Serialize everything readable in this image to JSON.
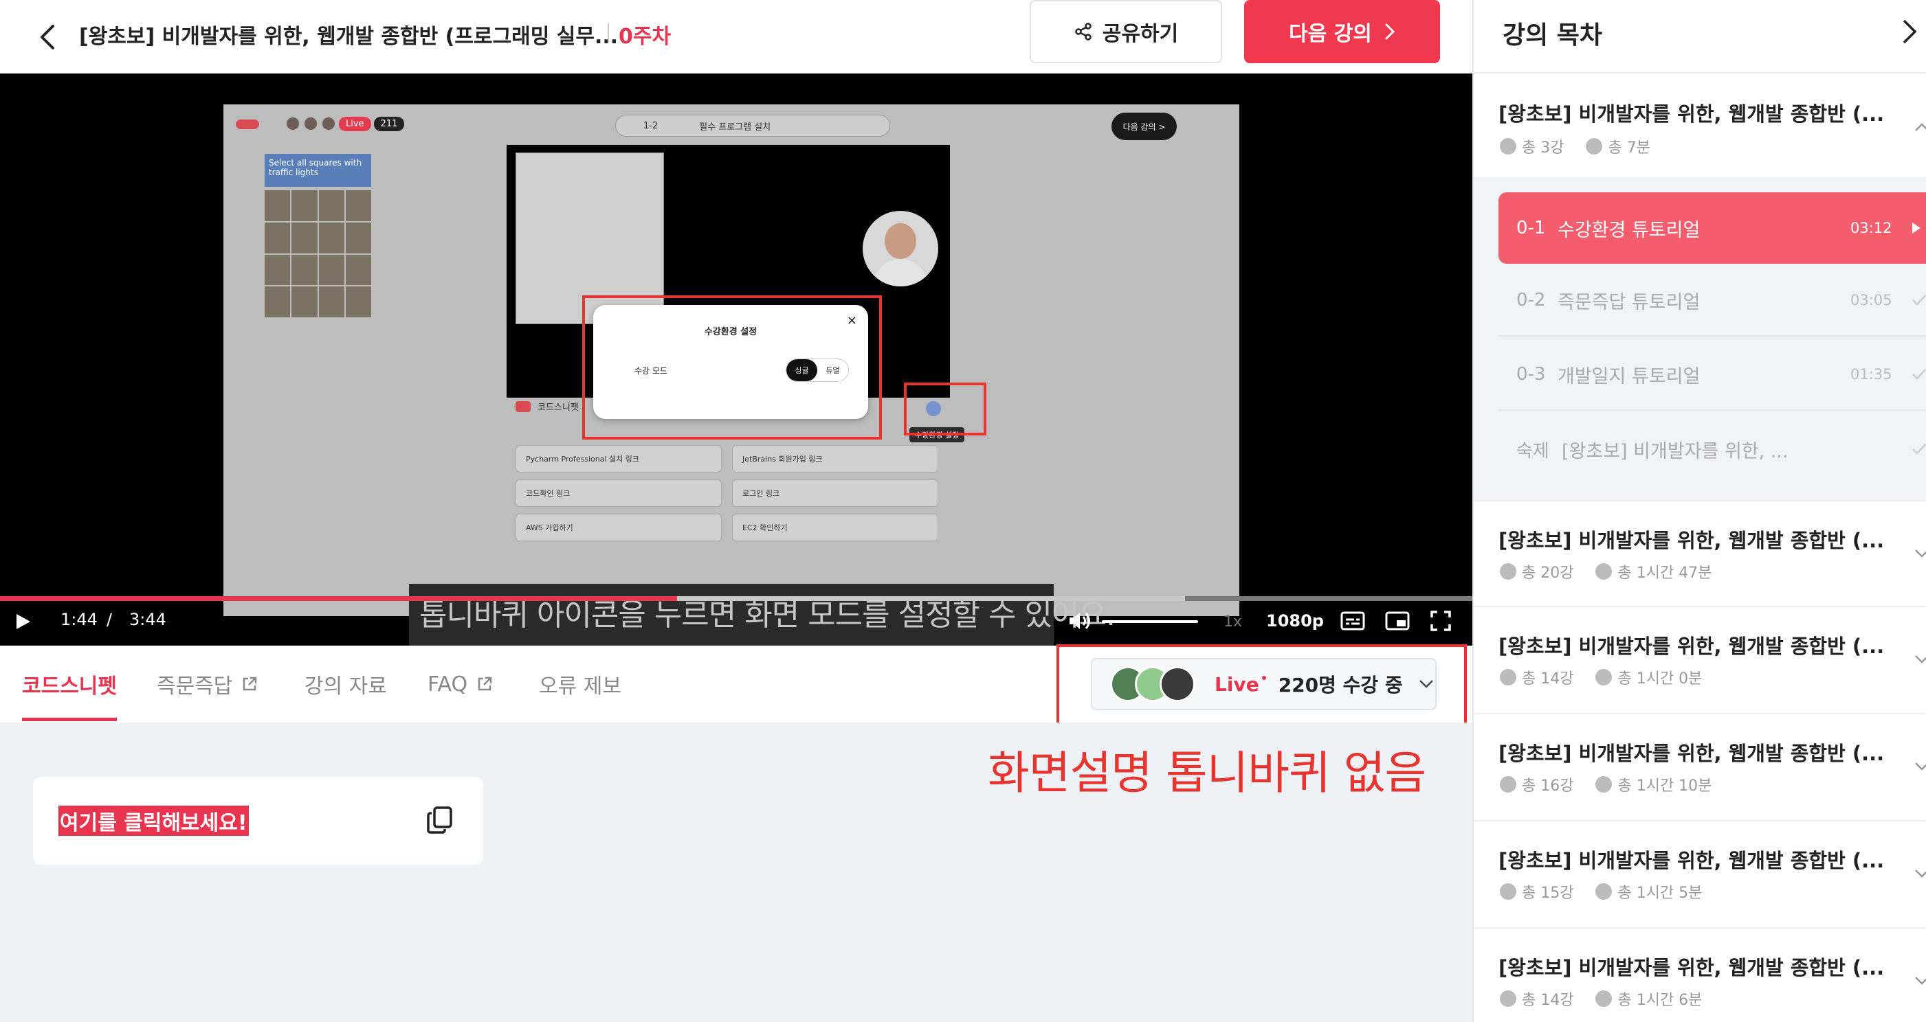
{
  "header": {
    "title": "[왕초보] 비개발자를 위한, 웹개발 종합반 (프로그래밍 실무...",
    "week": "0주차",
    "share_label": "공유하기",
    "next_label": "다음 강의"
  },
  "player": {
    "inner_screen": {
      "live_label": "Live",
      "live_count": "211",
      "select_number": "1-2",
      "select_label": "필수 프로그램 설치",
      "next_label": "다음 강의 >",
      "captcha_title": "Select all squares with traffic lights",
      "brand": "코드스니펫",
      "links": [
        "Pycharm Professional 설치 링크",
        "JetBrains 회원가입 링크",
        "코드확인 링크",
        "로그인 링크",
        "AWS 가입하기",
        "EC2 확인하기"
      ],
      "setting_tooltip": "수강환경 설정",
      "modal_title": "수강환경 설정",
      "modal_label": "수강 모드",
      "mode_on": "싱글",
      "mode_off": "듀얼"
    },
    "subtitle": "톱니바퀴 아이콘을 누르면 화면 모드를 설정할 수 있어요.",
    "current_time": "1:44",
    "time_sep": "/",
    "total_time": "3:44",
    "progress": 0.46,
    "buffer": 0.805,
    "speed": "1x",
    "quality": "1080p"
  },
  "tabs": [
    {
      "label": "코드스니펫",
      "active": true
    },
    {
      "label": "즉문즉답",
      "external": true
    },
    {
      "label": "강의 자료"
    },
    {
      "label": "FAQ",
      "external": true
    },
    {
      "label": "오류 제보"
    }
  ],
  "live": {
    "label": "Live",
    "count_text": "220명 수강 중"
  },
  "annotation": "화면설명 톱니바퀴 없음",
  "snippet": {
    "text": "여기를 클릭해보세요!"
  },
  "sidebar": {
    "title": "강의 목차",
    "sections": [
      {
        "title": "[왕초보] 비개발자를 위한, 웹개발 종합반 (...",
        "count": "총 3강",
        "duration": "총 7분",
        "expanded": true
      },
      {
        "title": "[왕초보] 비개발자를 위한, 웹개발 종합반 (...",
        "count": "총 20강",
        "duration": "총 1시간 47분"
      },
      {
        "title": "[왕초보] 비개발자를 위한, 웹개발 종합반 (...",
        "count": "총 14강",
        "duration": "총 1시간 0분"
      },
      {
        "title": "[왕초보] 비개발자를 위한, 웹개발 종합반 (...",
        "count": "총 16강",
        "duration": "총 1시간 10분"
      },
      {
        "title": "[왕초보] 비개발자를 위한, 웹개발 종합반 (...",
        "count": "총 15강",
        "duration": "총 1시간 5분"
      },
      {
        "title": "[왕초보] 비개발자를 위한, 웹개발 종합반 (...",
        "count": "총 14강",
        "duration": "총 1시간 6분"
      }
    ],
    "lessons": [
      {
        "num": "0-1",
        "name": "수강환경 튜토리얼",
        "duration": "03:12",
        "active": true
      },
      {
        "num": "0-2",
        "name": "즉문즉답 튜토리얼",
        "duration": "03:05"
      },
      {
        "num": "0-3",
        "name": "개발일지 튜토리얼",
        "duration": "01:35"
      },
      {
        "num": "숙제",
        "name": "[왕초보] 비개발자를 위한, ...",
        "duration": ""
      }
    ]
  },
  "colors": {
    "accent": "#f0394f",
    "annotation_red": "#e8342e",
    "active_lesson": "#f45d6e"
  }
}
